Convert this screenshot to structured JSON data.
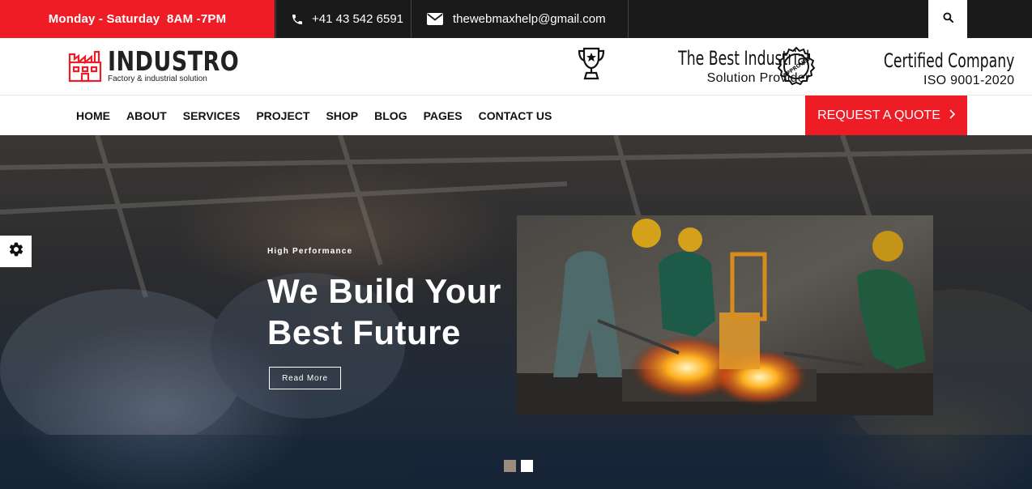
{
  "topbar": {
    "hours": "Monday - Saturday  8AM -7PM",
    "phone": "+41 43 542 6591",
    "email": "thewebmaxhelp@gmail.com",
    "accent": "#ee1c25"
  },
  "header": {
    "logo_name": "INDUSTRO",
    "logo_tagline": "Factory & industrial solution",
    "award1": {
      "title": "The Best Industrial",
      "subtitle": "Solution Provider"
    },
    "award2": {
      "title": "Certified Company",
      "subtitle": "ISO 9001-2020",
      "badge": "APPROVED"
    }
  },
  "nav": {
    "items": [
      "HOME",
      "ABOUT",
      "SERVICES",
      "PROJECT",
      "SHOP",
      "BLOG",
      "PAGES",
      "CONTACT US"
    ],
    "cta": "REQUEST A QUOTE"
  },
  "hero": {
    "eyebrow": "High Performance",
    "headline_line1": "We Build Your",
    "headline_line2": "Best Future",
    "button": "Read More",
    "slides": 2,
    "active_slide": 2
  }
}
